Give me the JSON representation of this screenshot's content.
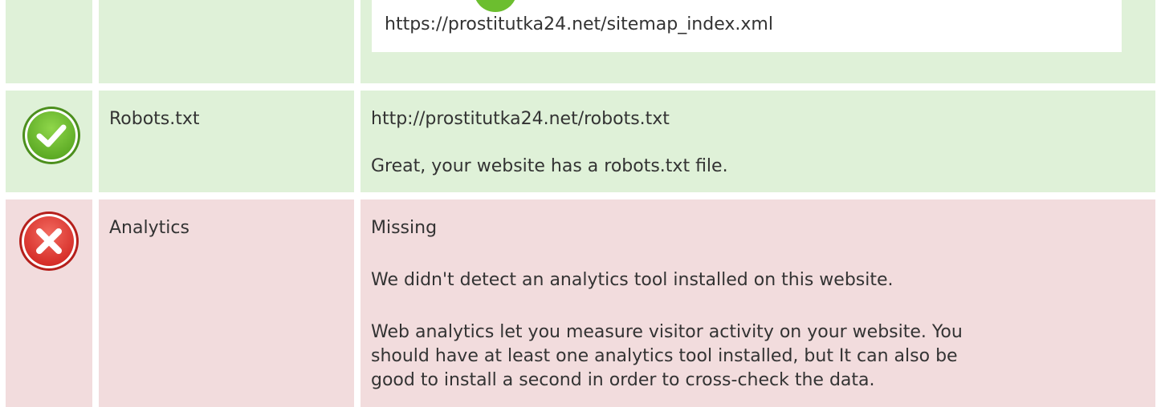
{
  "colors": {
    "pass_bg": "#dff1d8",
    "fail_bg": "#f2dcdd",
    "pass_icon": "#6cbe2f",
    "fail_icon": "#e43c36"
  },
  "sitemap": {
    "icon": "check-circle-icon",
    "url": "https://prostitutka24.net/sitemap_index.xml"
  },
  "robots": {
    "icon": "check-circle-icon",
    "label": "Robots.txt",
    "url": "http://prostitutka24.net/robots.txt",
    "message": "Great, your website has a robots.txt file."
  },
  "analytics": {
    "icon": "error-circle-icon",
    "label": "Analytics",
    "status": "Missing",
    "message": "We didn't detect an analytics tool installed on this website.",
    "advice_line1": "Web analytics let you measure visitor activity on your website. You",
    "advice_line2": "should have at least one analytics tool installed, but It can also be",
    "advice_line3": "good to install a second in order to cross-check the data."
  }
}
